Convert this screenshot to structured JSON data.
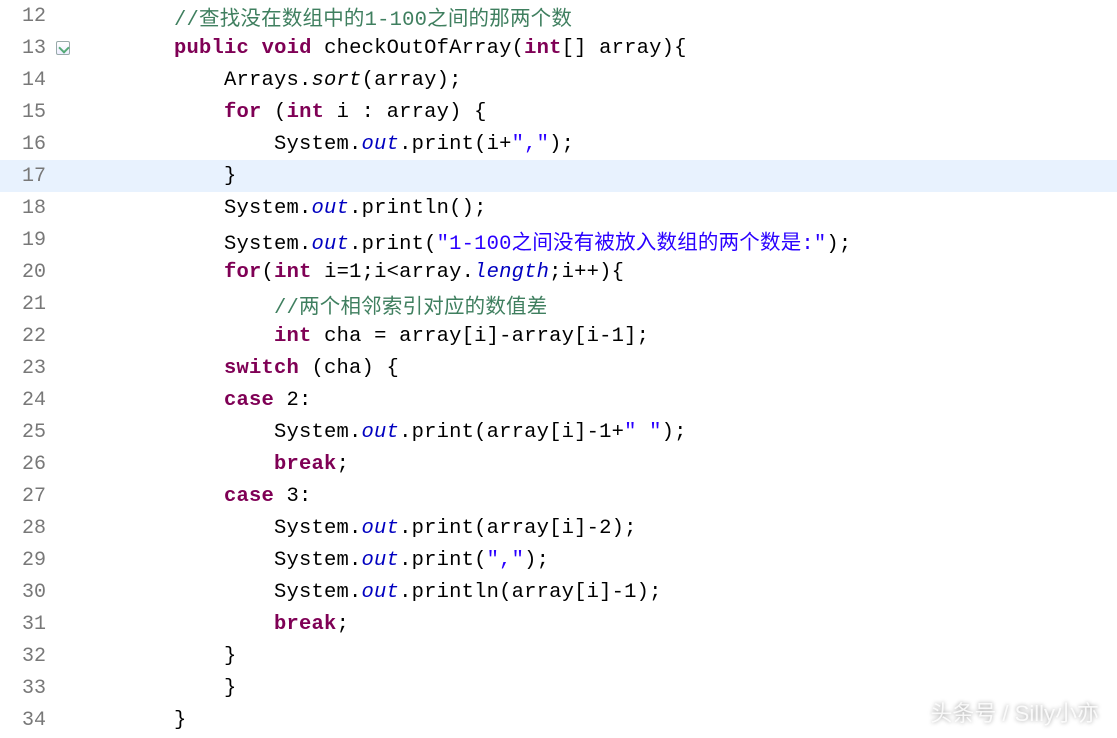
{
  "watermark": "头条号 / Silly小亦",
  "lines": [
    {
      "num": "12",
      "marker": "",
      "hl": false,
      "tokens": [
        {
          "t": "        ",
          "c": "plain"
        },
        {
          "t": "//查找没在数组中的1-100之间的那两个数",
          "c": "cm"
        }
      ]
    },
    {
      "num": "13",
      "marker": "override",
      "hl": false,
      "tokens": [
        {
          "t": "        ",
          "c": "plain"
        },
        {
          "t": "public",
          "c": "kw"
        },
        {
          "t": " ",
          "c": "plain"
        },
        {
          "t": "void",
          "c": "kw"
        },
        {
          "t": " checkOutOfArray(",
          "c": "plain"
        },
        {
          "t": "int",
          "c": "kw"
        },
        {
          "t": "[] array){",
          "c": "plain"
        }
      ]
    },
    {
      "num": "14",
      "marker": "",
      "hl": false,
      "tokens": [
        {
          "t": "            Arrays.",
          "c": "plain"
        },
        {
          "t": "sort",
          "c": "sm"
        },
        {
          "t": "(array);",
          "c": "plain"
        }
      ]
    },
    {
      "num": "15",
      "marker": "",
      "hl": false,
      "tokens": [
        {
          "t": "            ",
          "c": "plain"
        },
        {
          "t": "for",
          "c": "kw"
        },
        {
          "t": " (",
          "c": "plain"
        },
        {
          "t": "int",
          "c": "kw"
        },
        {
          "t": " i : array) {",
          "c": "plain"
        }
      ]
    },
    {
      "num": "16",
      "marker": "",
      "hl": false,
      "tokens": [
        {
          "t": "                System.",
          "c": "plain"
        },
        {
          "t": "out",
          "c": "sf"
        },
        {
          "t": ".print(i+",
          "c": "plain"
        },
        {
          "t": "\",\"",
          "c": "str"
        },
        {
          "t": ");",
          "c": "plain"
        }
      ]
    },
    {
      "num": "17",
      "marker": "",
      "hl": true,
      "tokens": [
        {
          "t": "            }",
          "c": "plain"
        }
      ]
    },
    {
      "num": "18",
      "marker": "",
      "hl": false,
      "tokens": [
        {
          "t": "            System.",
          "c": "plain"
        },
        {
          "t": "out",
          "c": "sf"
        },
        {
          "t": ".println();",
          "c": "plain"
        }
      ]
    },
    {
      "num": "19",
      "marker": "",
      "hl": false,
      "tokens": [
        {
          "t": "            System.",
          "c": "plain"
        },
        {
          "t": "out",
          "c": "sf"
        },
        {
          "t": ".print(",
          "c": "plain"
        },
        {
          "t": "\"1-100之间没有被放入数组的两个数是:\"",
          "c": "str"
        },
        {
          "t": ");",
          "c": "plain"
        }
      ]
    },
    {
      "num": "20",
      "marker": "",
      "hl": false,
      "tokens": [
        {
          "t": "            ",
          "c": "plain"
        },
        {
          "t": "for",
          "c": "kw"
        },
        {
          "t": "(",
          "c": "plain"
        },
        {
          "t": "int",
          "c": "kw"
        },
        {
          "t": " i=1;i<array.",
          "c": "plain"
        },
        {
          "t": "length",
          "c": "sf"
        },
        {
          "t": ";i++){",
          "c": "plain"
        }
      ]
    },
    {
      "num": "21",
      "marker": "",
      "hl": false,
      "tokens": [
        {
          "t": "                ",
          "c": "plain"
        },
        {
          "t": "//两个相邻索引对应的数值差",
          "c": "cm"
        }
      ]
    },
    {
      "num": "22",
      "marker": "",
      "hl": false,
      "tokens": [
        {
          "t": "                ",
          "c": "plain"
        },
        {
          "t": "int",
          "c": "kw"
        },
        {
          "t": " cha = array[i]-array[i-1];",
          "c": "plain"
        }
      ]
    },
    {
      "num": "23",
      "marker": "",
      "hl": false,
      "tokens": [
        {
          "t": "            ",
          "c": "plain"
        },
        {
          "t": "switch",
          "c": "kw"
        },
        {
          "t": " (cha) {",
          "c": "plain"
        }
      ]
    },
    {
      "num": "24",
      "marker": "",
      "hl": false,
      "tokens": [
        {
          "t": "            ",
          "c": "plain"
        },
        {
          "t": "case",
          "c": "kw"
        },
        {
          "t": " 2:",
          "c": "plain"
        }
      ]
    },
    {
      "num": "25",
      "marker": "",
      "hl": false,
      "tokens": [
        {
          "t": "                System.",
          "c": "plain"
        },
        {
          "t": "out",
          "c": "sf"
        },
        {
          "t": ".print(array[i]-1+",
          "c": "plain"
        },
        {
          "t": "\" \"",
          "c": "str"
        },
        {
          "t": ");",
          "c": "plain"
        }
      ]
    },
    {
      "num": "26",
      "marker": "",
      "hl": false,
      "tokens": [
        {
          "t": "                ",
          "c": "plain"
        },
        {
          "t": "break",
          "c": "kw"
        },
        {
          "t": ";",
          "c": "plain"
        }
      ]
    },
    {
      "num": "27",
      "marker": "",
      "hl": false,
      "tokens": [
        {
          "t": "            ",
          "c": "plain"
        },
        {
          "t": "case",
          "c": "kw"
        },
        {
          "t": " 3:",
          "c": "plain"
        }
      ]
    },
    {
      "num": "28",
      "marker": "",
      "hl": false,
      "tokens": [
        {
          "t": "                System.",
          "c": "plain"
        },
        {
          "t": "out",
          "c": "sf"
        },
        {
          "t": ".print(array[i]-2);",
          "c": "plain"
        }
      ]
    },
    {
      "num": "29",
      "marker": "",
      "hl": false,
      "tokens": [
        {
          "t": "                System.",
          "c": "plain"
        },
        {
          "t": "out",
          "c": "sf"
        },
        {
          "t": ".print(",
          "c": "plain"
        },
        {
          "t": "\",\"",
          "c": "str"
        },
        {
          "t": ");",
          "c": "plain"
        }
      ]
    },
    {
      "num": "30",
      "marker": "",
      "hl": false,
      "tokens": [
        {
          "t": "                System.",
          "c": "plain"
        },
        {
          "t": "out",
          "c": "sf"
        },
        {
          "t": ".println(array[i]-1);",
          "c": "plain"
        }
      ]
    },
    {
      "num": "31",
      "marker": "",
      "hl": false,
      "tokens": [
        {
          "t": "                ",
          "c": "plain"
        },
        {
          "t": "break",
          "c": "kw"
        },
        {
          "t": ";",
          "c": "plain"
        }
      ]
    },
    {
      "num": "32",
      "marker": "",
      "hl": false,
      "tokens": [
        {
          "t": "            }",
          "c": "plain"
        }
      ]
    },
    {
      "num": "33",
      "marker": "",
      "hl": false,
      "tokens": [
        {
          "t": "            }",
          "c": "plain"
        }
      ]
    },
    {
      "num": "34",
      "marker": "",
      "hl": false,
      "tokens": [
        {
          "t": "        }",
          "c": "plain"
        }
      ]
    }
  ]
}
